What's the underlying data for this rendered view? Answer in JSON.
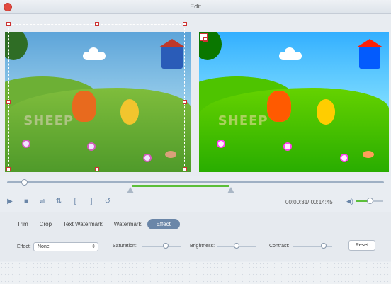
{
  "window": {
    "title": "Edit"
  },
  "left_preview": {
    "caption_text": "SHEEP"
  },
  "right_preview": {
    "caption_text": "SHEEP"
  },
  "playback": {
    "time_current": "00:00:31",
    "time_total": "00:14:45",
    "time_display": "00:00:31/ 00:14:45",
    "buttons": [
      "play-icon",
      "stop-icon",
      "flip-horizontal-icon",
      "flip-vertical-icon",
      "mark-in-icon",
      "mark-out-icon",
      "undo-icon"
    ],
    "glyphs": {
      "play": "▶",
      "stop": "■",
      "flip_h": "⇌",
      "flip_v": "⇅",
      "mark_in": "[",
      "mark_out": "]",
      "undo": "↺",
      "volume": "◀)"
    },
    "volume_level": 0.5,
    "progress_fraction": 0.04
  },
  "tabs": [
    "Trim",
    "Crop",
    "Text Watermark",
    "Watermark",
    "Effect"
  ],
  "active_tab": "Effect",
  "effect": {
    "label": "Effect:",
    "selected": "None",
    "saturation_label": "Saturation:",
    "brightness_label": "Brightness:",
    "contrast_label": "Contrast:",
    "saturation_value": 0.5,
    "brightness_value": 0.5,
    "contrast_value": 0.75,
    "reset_label": "Reset"
  },
  "colors": {
    "accent": "#6a86a8",
    "trim_green": "#5cbf3a",
    "close_red": "#e2493f"
  }
}
